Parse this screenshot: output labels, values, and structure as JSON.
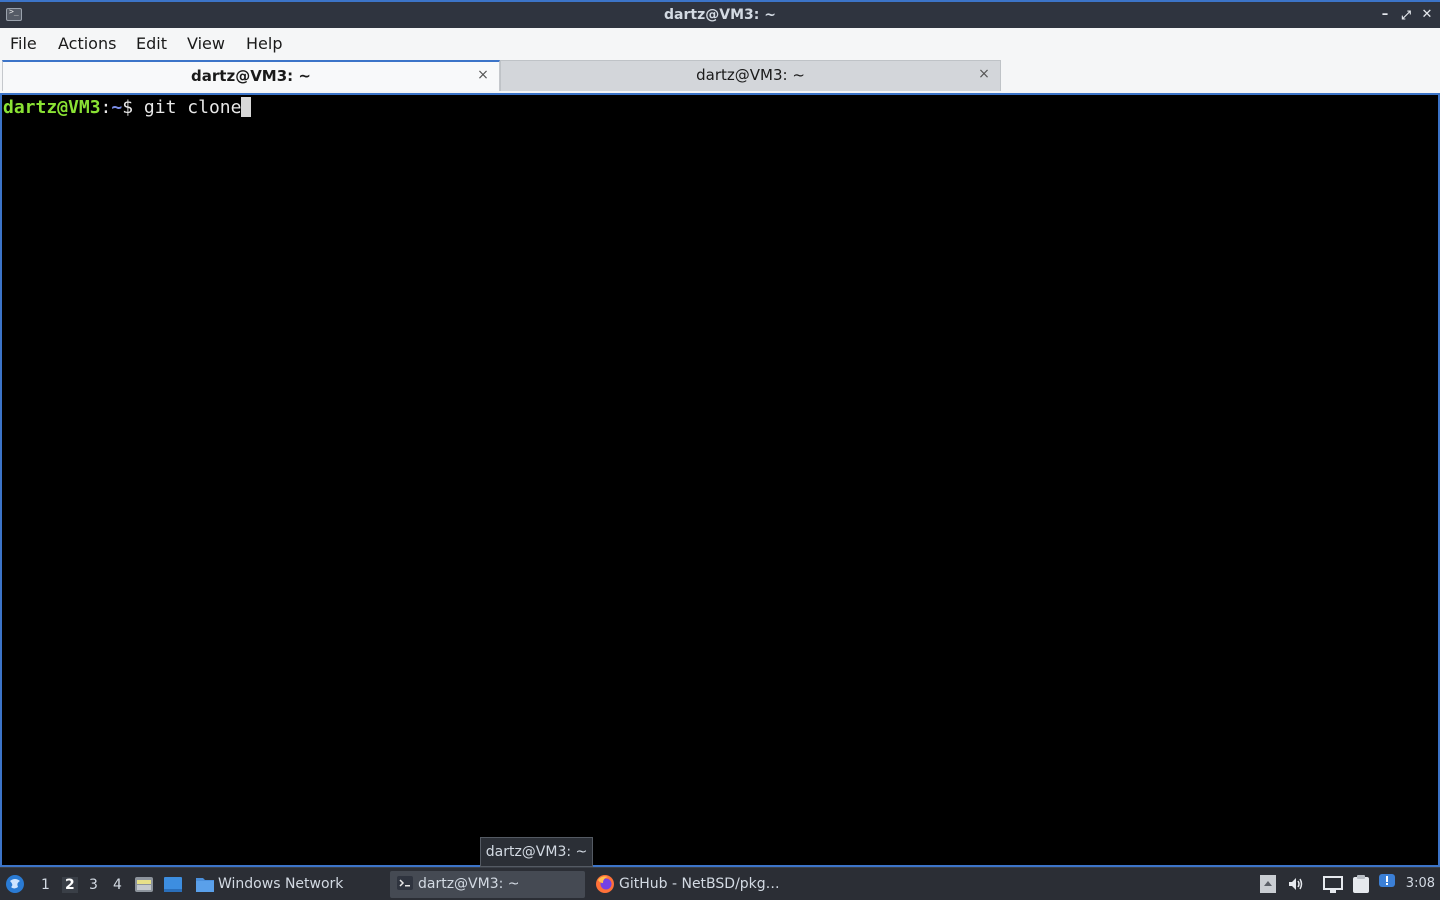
{
  "window": {
    "title": "dartz@VM3: ~",
    "app_icon": "terminal-icon",
    "minimize_glyph": "–",
    "maximize_glyph": "⤢",
    "close_glyph": "✕"
  },
  "menubar": {
    "items": [
      "File",
      "Actions",
      "Edit",
      "View",
      "Help"
    ]
  },
  "tabs": [
    {
      "label": "dartz@VM3: ~",
      "active": true,
      "close_glyph": "×"
    },
    {
      "label": "dartz@VM3: ~",
      "active": false,
      "close_glyph": "×"
    }
  ],
  "terminal": {
    "prompt_user": "dartz@VM3",
    "prompt_colon": ":",
    "prompt_path": "~",
    "prompt_dollar": "$ ",
    "command": "git clone",
    "colors": {
      "user": "#8ae234",
      "path": "#7b8ee8",
      "text": "#e8e8e8",
      "background": "#000000"
    }
  },
  "tooltip": {
    "text": "dartz@VM3: ~"
  },
  "taskbar": {
    "menu_icon": "lxqt-menu-icon",
    "desktops": [
      "1",
      "2",
      "3",
      "4"
    ],
    "current_desktop": "2",
    "quicklaunch": [
      "file-manager-icon",
      "show-desktop-icon"
    ],
    "tasks": [
      {
        "label": "Windows Network",
        "icon": "folder-icon",
        "active": false
      },
      {
        "label": "dartz@VM3: ~",
        "icon": "terminal-icon",
        "active": true
      },
      {
        "label": "GitHub - NetBSD/pkg…",
        "icon": "firefox-icon",
        "active": false
      }
    ],
    "tray": [
      "tray-expand-icon",
      "volume-icon",
      "display-icon",
      "clipboard-icon",
      "notification-icon"
    ],
    "clock": "3:08"
  },
  "accent_color": "#3c74c8"
}
